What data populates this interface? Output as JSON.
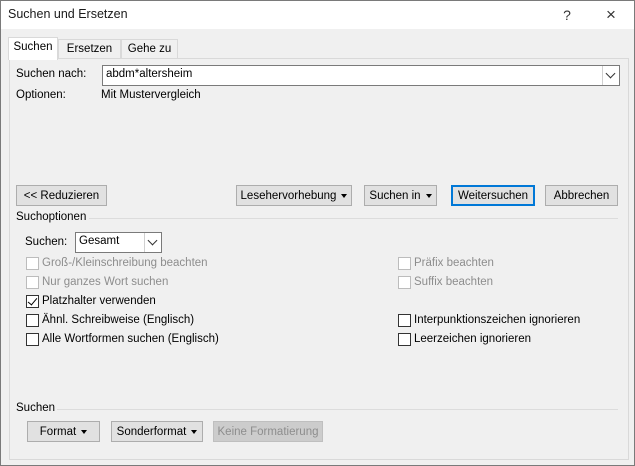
{
  "window": {
    "title": "Suchen und Ersetzen",
    "help": "?",
    "close": "×"
  },
  "tabs": [
    {
      "label": "Suchen",
      "active": true
    },
    {
      "label": "Ersetzen",
      "active": false
    },
    {
      "label": "Gehe zu",
      "active": false
    }
  ],
  "search": {
    "label": "Suchen nach:",
    "value": "abdm*altersheim",
    "options_label": "Optionen:",
    "options_value": "Mit Mustervergleich"
  },
  "buttons": {
    "reduce": "<< Reduzieren",
    "reading_highlight": "Lesehervorhebung",
    "find_in": "Suchen in",
    "find_next": "Weitersuchen",
    "cancel": "Abbrechen"
  },
  "search_options": {
    "group_label": "Suchoptionen",
    "direction_label": "Suchen:",
    "direction_value": "Gesamt",
    "checkboxes_left": [
      {
        "label": "Groß-/Kleinschreibung beachten",
        "checked": false,
        "enabled": false
      },
      {
        "label": "Nur ganzes Wort suchen",
        "checked": false,
        "enabled": false
      },
      {
        "label": "Platzhalter verwenden",
        "checked": true,
        "enabled": true
      },
      {
        "label": "Ähnl. Schreibweise (Englisch)",
        "checked": false,
        "enabled": true
      },
      {
        "label": "Alle Wortformen suchen (Englisch)",
        "checked": false,
        "enabled": true
      }
    ],
    "checkboxes_right": [
      {
        "label": "Präfix beachten",
        "checked": false,
        "enabled": false
      },
      {
        "label": "Suffix beachten",
        "checked": false,
        "enabled": false
      },
      {
        "label": "Interpunktionszeichen ignorieren",
        "checked": false,
        "enabled": true
      },
      {
        "label": "Leerzeichen ignorieren",
        "checked": false,
        "enabled": true
      }
    ]
  },
  "format_section": {
    "group_label": "Suchen",
    "format": "Format",
    "special": "Sonderformat",
    "no_formatting": "Keine Formatierung"
  },
  "colors": {
    "accent": "#0078d7",
    "disabled_text": "#8d8d8d"
  }
}
